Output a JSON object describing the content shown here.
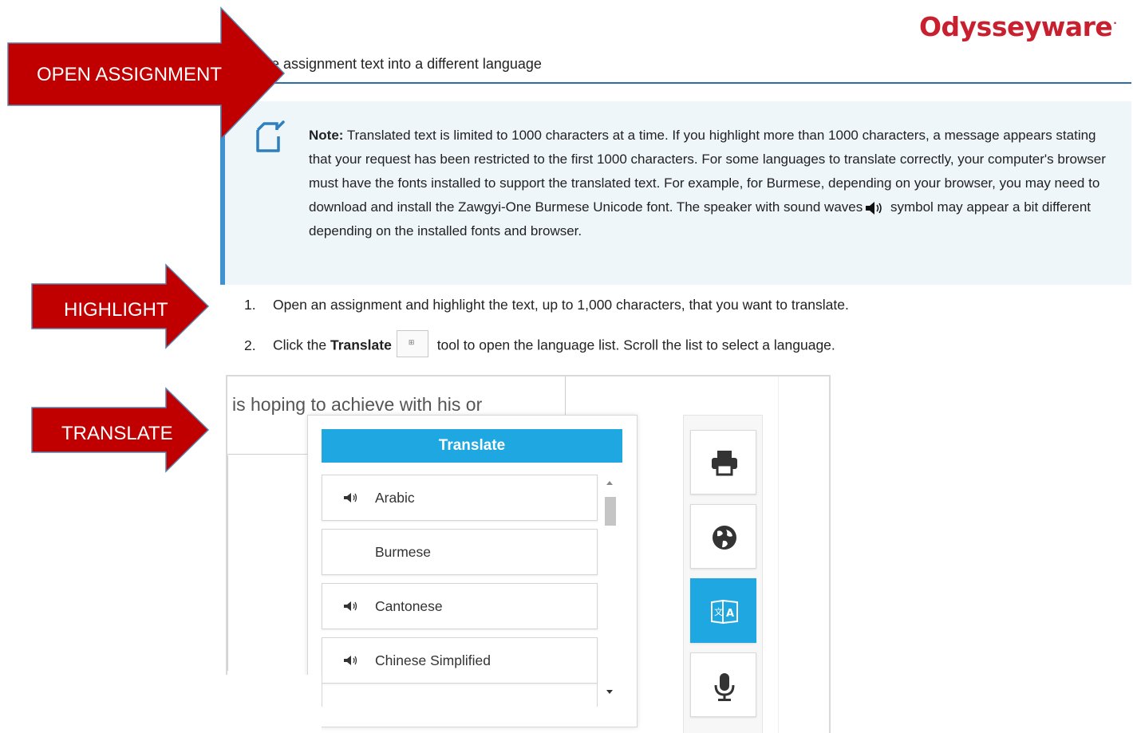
{
  "brand": {
    "name": "Odysseyware",
    "mark": "·"
  },
  "header": {
    "subtitle": "e assignment text into a different language"
  },
  "note": {
    "label": "Note:",
    "text_1": " Translated text is limited to 1000 characters at a time. If you highlight more than 1000 characters, a message appears stating that your request has been restricted to the first 1000 characters. For some languages to translate correctly, your computer's browser must have the fonts installed to support the translated text. For example, for Burmese, depending on your browser, you may need to download and install the Zawgyi-One Burmese Unicode font. The speaker with sound waves",
    "text_2": " symbol may appear a bit different depending on the installed fonts and browser."
  },
  "steps": [
    {
      "num": "1.",
      "text": "Open an assignment and highlight the text, up to 1,000 characters, that you want to translate."
    },
    {
      "num": "2.",
      "pre": "Click the ",
      "bold": "Translate",
      "post": " tool to open the language list. Scroll the list to select a language."
    }
  ],
  "screenshot": {
    "assignment_text": "is hoping to achieve with his or",
    "popup_title": "Translate",
    "languages": [
      {
        "label": "Arabic",
        "audio": true
      },
      {
        "label": "Burmese",
        "audio": false
      },
      {
        "label": "Cantonese",
        "audio": true
      },
      {
        "label": "Chinese Simplified",
        "audio": true
      }
    ],
    "tools": [
      "printer-icon",
      "globe-icon",
      "translate-icon",
      "microphone-icon"
    ]
  },
  "callouts": {
    "open_assignment": "OPEN ASSIGNMENT",
    "highlight": "HIGHLIGHT",
    "translate": "TRANSLATE"
  },
  "colors": {
    "arrow": "#c00000",
    "brand": "#c8202f",
    "accent": "#1ea7e1",
    "note_bg": "#eef6fa",
    "note_bar": "#3e92cf"
  }
}
